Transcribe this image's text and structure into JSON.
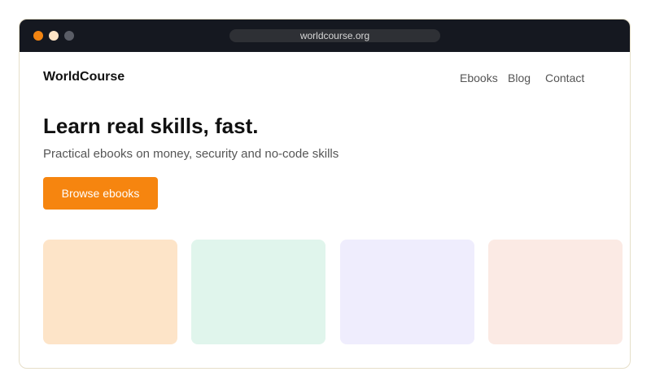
{
  "browser": {
    "url": "worldcourse.org",
    "window_controls": [
      {
        "name": "close",
        "color": "#f28411"
      },
      {
        "name": "minimize",
        "color": "#fde3c5"
      },
      {
        "name": "maximize",
        "color": "#5a5d66"
      }
    ]
  },
  "header": {
    "brand": "WorldCourse",
    "nav": [
      "Ebooks",
      "Blog",
      "Contact"
    ]
  },
  "hero": {
    "title": "Learn real skills, fast.",
    "subtitle": "Practical ebooks on money, security and no-code skills",
    "cta_label": "Browse ebooks",
    "cta_color": "#f6850f"
  },
  "cards": [
    {
      "color": "#fde4c8"
    },
    {
      "color": "#e0f5ec"
    },
    {
      "color": "#efedfd"
    },
    {
      "color": "#fbeae4"
    }
  ]
}
